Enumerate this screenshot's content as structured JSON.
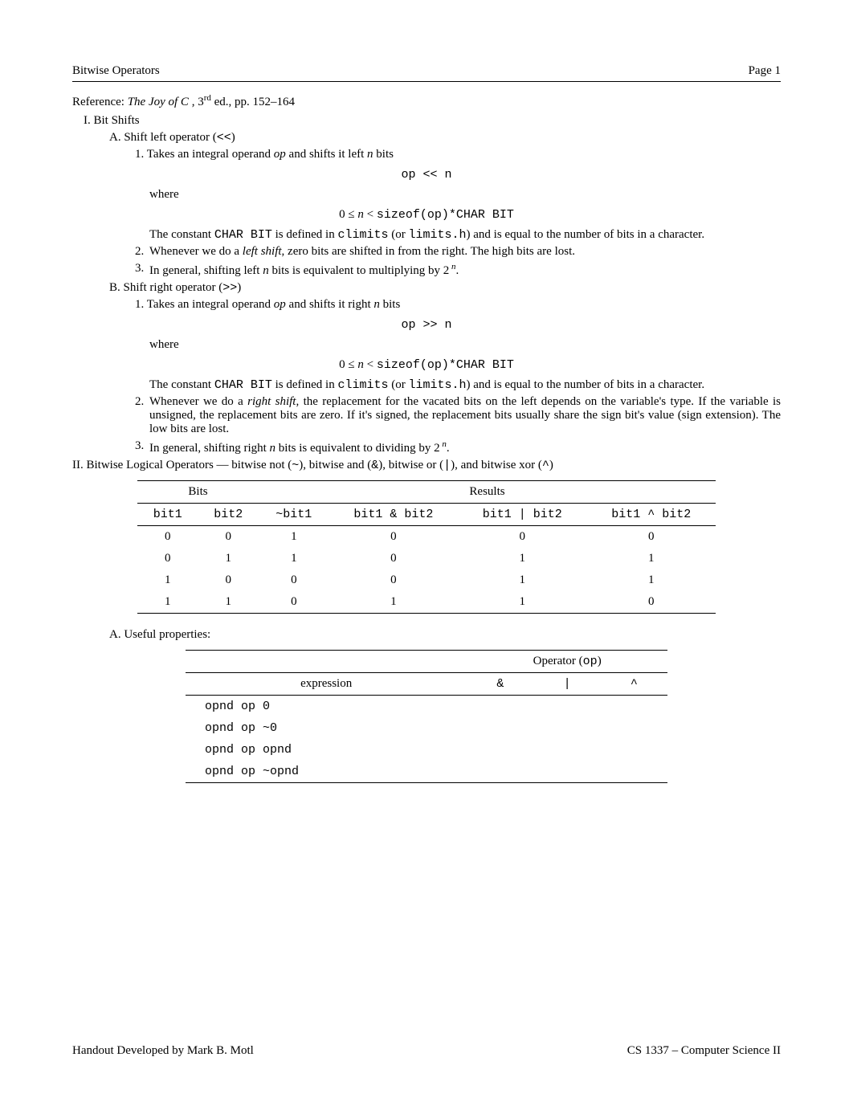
{
  "header": {
    "left": "Bitwise Operators",
    "right": "Page 1"
  },
  "reference": {
    "label": "Reference:",
    "book": "The Joy of C",
    "edn": " , 3",
    "sup": "rd",
    "tail": " ed., pp. 152–164"
  },
  "I": {
    "title": "I. Bit Shifts",
    "A": {
      "title": "A. Shift left operator (",
      "op": "<<",
      "close": ")",
      "one_a": "1. Takes an integral operand ",
      "one_op": "op",
      "one_b": " and shifts it left ",
      "one_n": "n",
      "one_c": " bits",
      "code1": "op << n",
      "where": "where",
      "ineq_a": "0 ≤ ",
      "ineq_n": "n",
      "ineq_b": " < ",
      "ineq_c": "sizeof(op)*CHAR BIT",
      "const_a": "The constant ",
      "const_b": "CHAR BIT",
      "const_c": " is defined in ",
      "const_d": "climits",
      "const_e": " (or ",
      "const_f": "limits.h",
      "const_g": ") and is equal to the number of bits in a character.",
      "two_a": "Whenever we do a ",
      "two_i": "left shift",
      "two_b": ", zero bits are shifted in from the right. The high bits are lost.",
      "three_a": "In general, shifting left ",
      "three_n": "n",
      "three_b": " bits is equivalent to multiplying by 2",
      "three_sup": " n",
      "three_c": "."
    },
    "B": {
      "title": "B. Shift right operator (",
      "op": ">>",
      "close": ")",
      "one_a": "1. Takes an integral operand ",
      "one_op": "op",
      "one_b": " and shifts it right ",
      "one_n": "n",
      "one_c": " bits",
      "code1": "op >> n",
      "where": "where",
      "ineq_a": "0 ≤ ",
      "ineq_n": "n",
      "ineq_b": " < ",
      "ineq_c": "sizeof(op)*CHAR BIT",
      "const_a": "The constant ",
      "const_b": "CHAR BIT",
      "const_c": " is defined in ",
      "const_d": "climits",
      "const_e": " (or ",
      "const_f": "limits.h",
      "const_g": ") and is equal to the number of bits in a character.",
      "two_a": "Whenever we do a ",
      "two_i": "right shift",
      "two_b": ", the replacement for the vacated bits on the left depends on the variable's type. If the variable is unsigned, the replacement bits are zero. If it's signed, the replacement bits usually share the sign bit's value (sign extension). The low bits are lost.",
      "three_a": "In general, shifting right ",
      "three_n": "n",
      "three_b": " bits is equivalent to dividing by 2",
      "three_sup": " n",
      "three_c": "."
    }
  },
  "II": {
    "title_a": "II. Bitwise Logical Operators — bitwise not (",
    "t1": "~",
    "title_b": "), bitwise and (",
    "t2": "&",
    "title_c": "), bitwise or (",
    "t3": "|",
    "title_d": "), and bitwise xor (",
    "t4": "^",
    "title_e": ")"
  },
  "table1": {
    "h_bits": "Bits",
    "h_results": "Results",
    "h": [
      "bit1",
      "bit2",
      "~bit1",
      "bit1 & bit2",
      "bit1 | bit2",
      "bit1 ^ bit2"
    ],
    "rows": [
      [
        "0",
        "0",
        "1",
        "0",
        "0",
        "0"
      ],
      [
        "0",
        "1",
        "1",
        "0",
        "1",
        "1"
      ],
      [
        "1",
        "0",
        "0",
        "0",
        "1",
        "1"
      ],
      [
        "1",
        "1",
        "0",
        "1",
        "1",
        "0"
      ]
    ]
  },
  "A2": {
    "title": "A. Useful properties:"
  },
  "table2": {
    "h_op": "Operator (",
    "h_op_tt": "op",
    "h_op_close": ")",
    "h_expr": "expression",
    "ops": [
      "&",
      "|",
      "^"
    ],
    "rows": [
      "opnd op 0",
      "opnd op ~0",
      "opnd op opnd",
      "opnd op ~opnd"
    ]
  },
  "footer": {
    "left": "Handout Developed by Mark B. Motl",
    "right": "CS 1337 – Computer Science II"
  }
}
